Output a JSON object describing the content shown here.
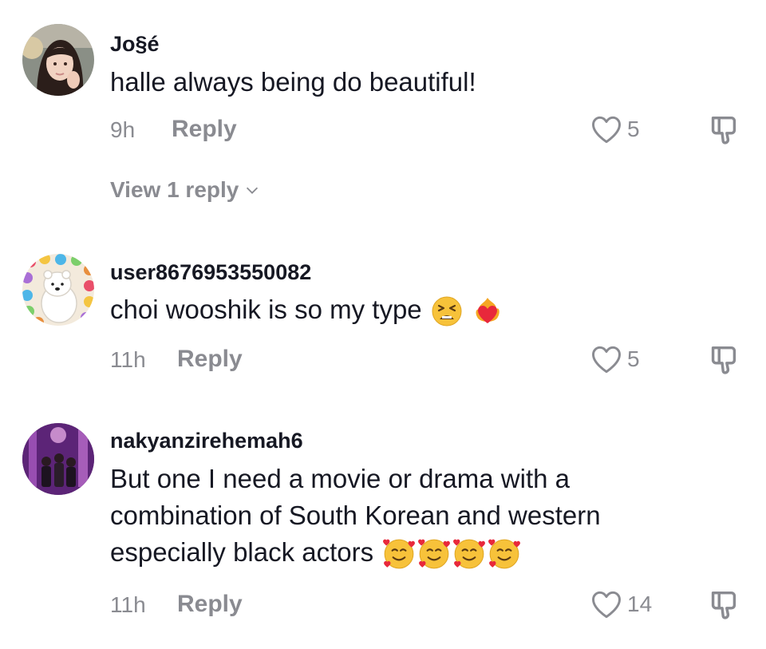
{
  "comments": [
    {
      "username": "Jo§é",
      "text": "halle always being do beautiful!",
      "time": "9h",
      "reply_label": "Reply",
      "likes": "5",
      "view_replies": "View 1 reply",
      "avatar": "girl-selfie-avatar"
    },
    {
      "username": "user8676953550082",
      "text": "choi wooshik is so my type",
      "emojis": [
        "tired-face-emoji",
        "heart-on-fire-emoji"
      ],
      "time": "11h",
      "reply_label": "Reply",
      "likes": "5",
      "avatar": "polar-bear-avatar"
    },
    {
      "username": "nakyanzirehemah6",
      "text_lines": [
        "But one I need a movie or drama with a",
        "combination of South Korean and western",
        "especially black actors"
      ],
      "emojis": [
        "smiling-face-with-hearts-emoji",
        "smiling-face-with-hearts-emoji",
        "smiling-face-with-hearts-emoji",
        "smiling-face-with-hearts-emoji"
      ],
      "time": "11h",
      "reply_label": "Reply",
      "likes": "14",
      "avatar": "concert-friends-avatar"
    }
  ],
  "icons": {
    "like": "heart-outline-icon",
    "dislike": "thumbs-down-icon",
    "expand": "chevron-down-icon"
  },
  "colors": {
    "text": "#161823",
    "secondary": "#8a8b91"
  }
}
